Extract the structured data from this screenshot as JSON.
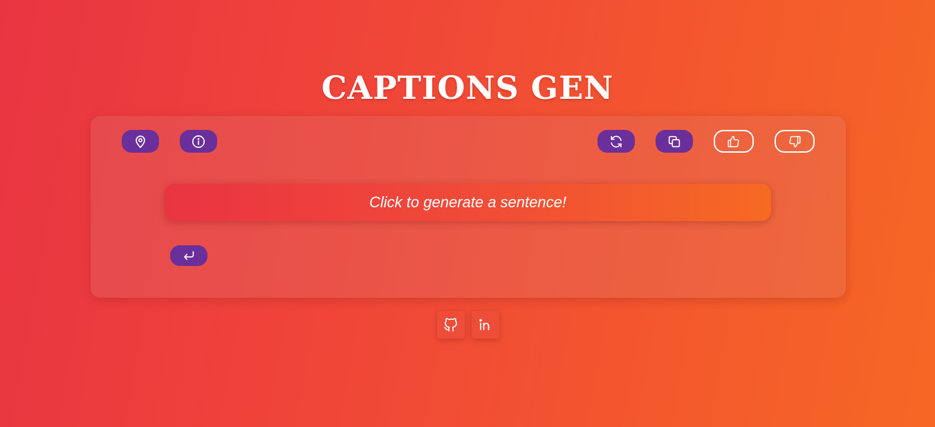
{
  "header": {
    "title": "CAPTIONS GEN"
  },
  "toolbar": {
    "left_buttons": [
      {
        "icon": "location-pin-icon"
      },
      {
        "icon": "info-icon"
      }
    ],
    "right_buttons": [
      {
        "icon": "refresh-icon"
      },
      {
        "icon": "copy-icon"
      },
      {
        "icon": "thumbs-up-icon"
      },
      {
        "icon": "thumbs-down-icon"
      }
    ]
  },
  "main": {
    "sentence_prompt": "Click to generate a sentence!",
    "enter_icon": "enter-arrow-icon"
  },
  "footer": {
    "links": [
      {
        "icon": "github-icon"
      },
      {
        "icon": "linkedin-icon"
      }
    ]
  },
  "colors": {
    "background_start": "#e93542",
    "background_end": "#f66724",
    "button_purple": "#6a2f9b",
    "text": "#ffffff"
  }
}
